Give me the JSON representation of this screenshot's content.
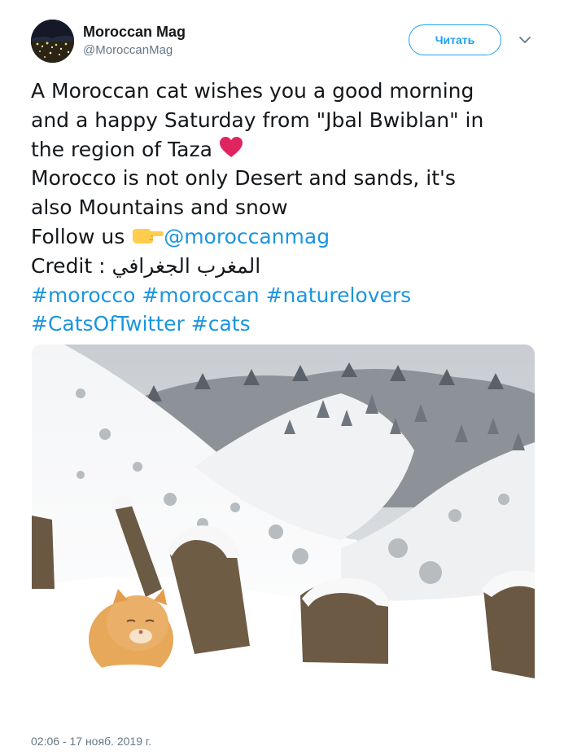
{
  "account": {
    "display_name": "Moroccan Mag",
    "handle": "@MoroccanMag"
  },
  "follow_button": {
    "label": "Читать"
  },
  "tweet": {
    "line1": "A Moroccan cat wishes you a good morning",
    "line2": "and a happy Saturday from \"Jbal Bwiblan\" in",
    "line3": "the region of Taza",
    "line4": "Morocco is not only Desert and sands, it's",
    "line5": "also Mountains and snow",
    "follow_prefix": "Follow us",
    "mention": "@moroccanmag",
    "credit_prefix": "Credit :",
    "credit_arabic": "المغرب الجغرافي",
    "hashtags_line1": [
      "#morocco",
      "#moroccan",
      "#naturelovers"
    ],
    "hashtags_line2": [
      "#CatsOfTwitter",
      "#cats"
    ]
  },
  "timestamp": "02:06 - 17 нояб. 2019 г.",
  "colors": {
    "link": "#1b95e0",
    "follow_border": "#1da1f2",
    "heart": "#e0245e",
    "secondary_text": "#657786"
  },
  "icons": [
    "chevron-down-icon",
    "red-heart-emoji-icon",
    "pointing-right-emoji-icon"
  ]
}
